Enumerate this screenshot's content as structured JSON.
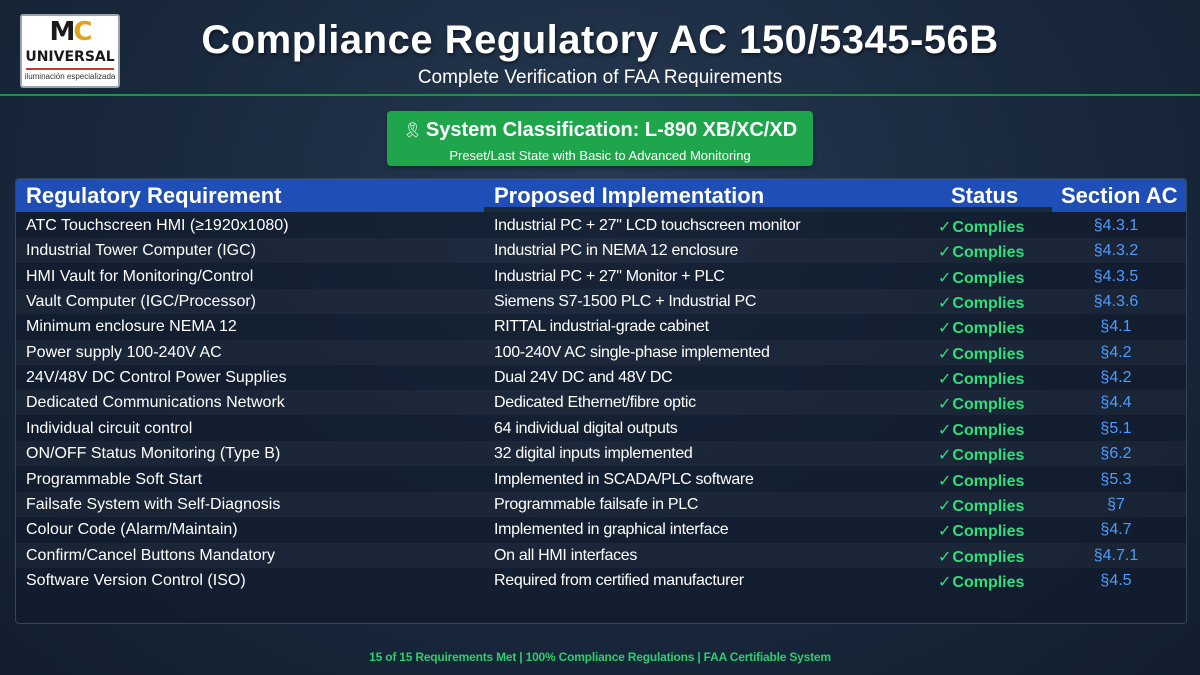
{
  "logo": {
    "mark_m": "M",
    "mark_c": "C",
    "name": "UNIVERSAL",
    "tagline": "iluminación especializada"
  },
  "header": {
    "title": "Compliance Regulatory AC 150/5345-56B",
    "subtitle": "Complete Verification of FAA Requirements"
  },
  "classification": {
    "icon": "medal-icon",
    "title": "System Classification: L-890 XB/XC/XD",
    "subtitle": "Preset/Last State with Basic to Advanced Monitoring"
  },
  "table": {
    "headers": {
      "requirement": "Regulatory Requirement",
      "implementation": "Proposed Implementation",
      "status": "Status",
      "section": "Section AC"
    },
    "status_check": "✓",
    "rows": [
      {
        "requirement": "ATC Touchscreen HMI (≥1920x1080)",
        "implementation": "Industrial PC + 27\" LCD touchscreen monitor",
        "status": "Complies",
        "section": "§4.3.1"
      },
      {
        "requirement": "Industrial Tower Computer (IGC)",
        "implementation": "Industrial PC in NEMA 12 enclosure",
        "status": "Complies",
        "section": "§4.3.2"
      },
      {
        "requirement": "HMI Vault for Monitoring/Control",
        "implementation": "Industrial PC + 27\" Monitor + PLC",
        "status": "Complies",
        "section": "§4.3.5"
      },
      {
        "requirement": "Vault Computer (IGC/Processor)",
        "implementation": "Siemens S7-1500 PLC + Industrial PC",
        "status": "Complies",
        "section": "§4.3.6"
      },
      {
        "requirement": "Minimum enclosure NEMA 12",
        "implementation": "RITTAL industrial-grade cabinet",
        "status": "Complies",
        "section": "§4.1"
      },
      {
        "requirement": "Power supply 100-240V AC",
        "implementation": "100-240V AC single-phase implemented",
        "status": "Complies",
        "section": "§4.2"
      },
      {
        "requirement": "24V/48V DC Control Power Supplies",
        "implementation": "Dual 24V DC and 48V DC",
        "status": "Complies",
        "section": "§4.2"
      },
      {
        "requirement": "Dedicated Communications Network",
        "implementation": "Dedicated Ethernet/fibre optic",
        "status": "Complies",
        "section": "§4.4"
      },
      {
        "requirement": "Individual circuit control",
        "implementation": "64 individual digital outputs",
        "status": "Complies",
        "section": "§5.1"
      },
      {
        "requirement": "ON/OFF Status Monitoring (Type B)",
        "implementation": "32 digital inputs implemented",
        "status": "Complies",
        "section": "§6.2"
      },
      {
        "requirement": "Programmable Soft Start",
        "implementation": "Implemented in SCADA/PLC software",
        "status": "Complies",
        "section": "§5.3"
      },
      {
        "requirement": "Failsafe System with Self-Diagnosis",
        "implementation": "Programmable failsafe in PLC",
        "status": "Complies",
        "section": "§7"
      },
      {
        "requirement": "Colour Code (Alarm/Maintain)",
        "implementation": "Implemented in graphical interface",
        "status": "Complies",
        "section": "§4.7"
      },
      {
        "requirement": "Confirm/Cancel Buttons Mandatory",
        "implementation": "On all HMI interfaces",
        "status": "Complies",
        "section": "§4.7.1"
      },
      {
        "requirement": "Software Version Control (ISO)",
        "implementation": "Required from certified manufacturer",
        "status": "Complies",
        "section": "§4.5"
      }
    ]
  },
  "footer": {
    "summary": "15 of 15 Requirements Met | 100% Compliance Regulations | FAA Certifiable System"
  },
  "colors": {
    "accent_green": "#1fa54c",
    "status_green": "#2ee07a",
    "header_blue": "#1f4fb6",
    "section_blue": "#4f9bff",
    "background": "#1b2b40"
  }
}
